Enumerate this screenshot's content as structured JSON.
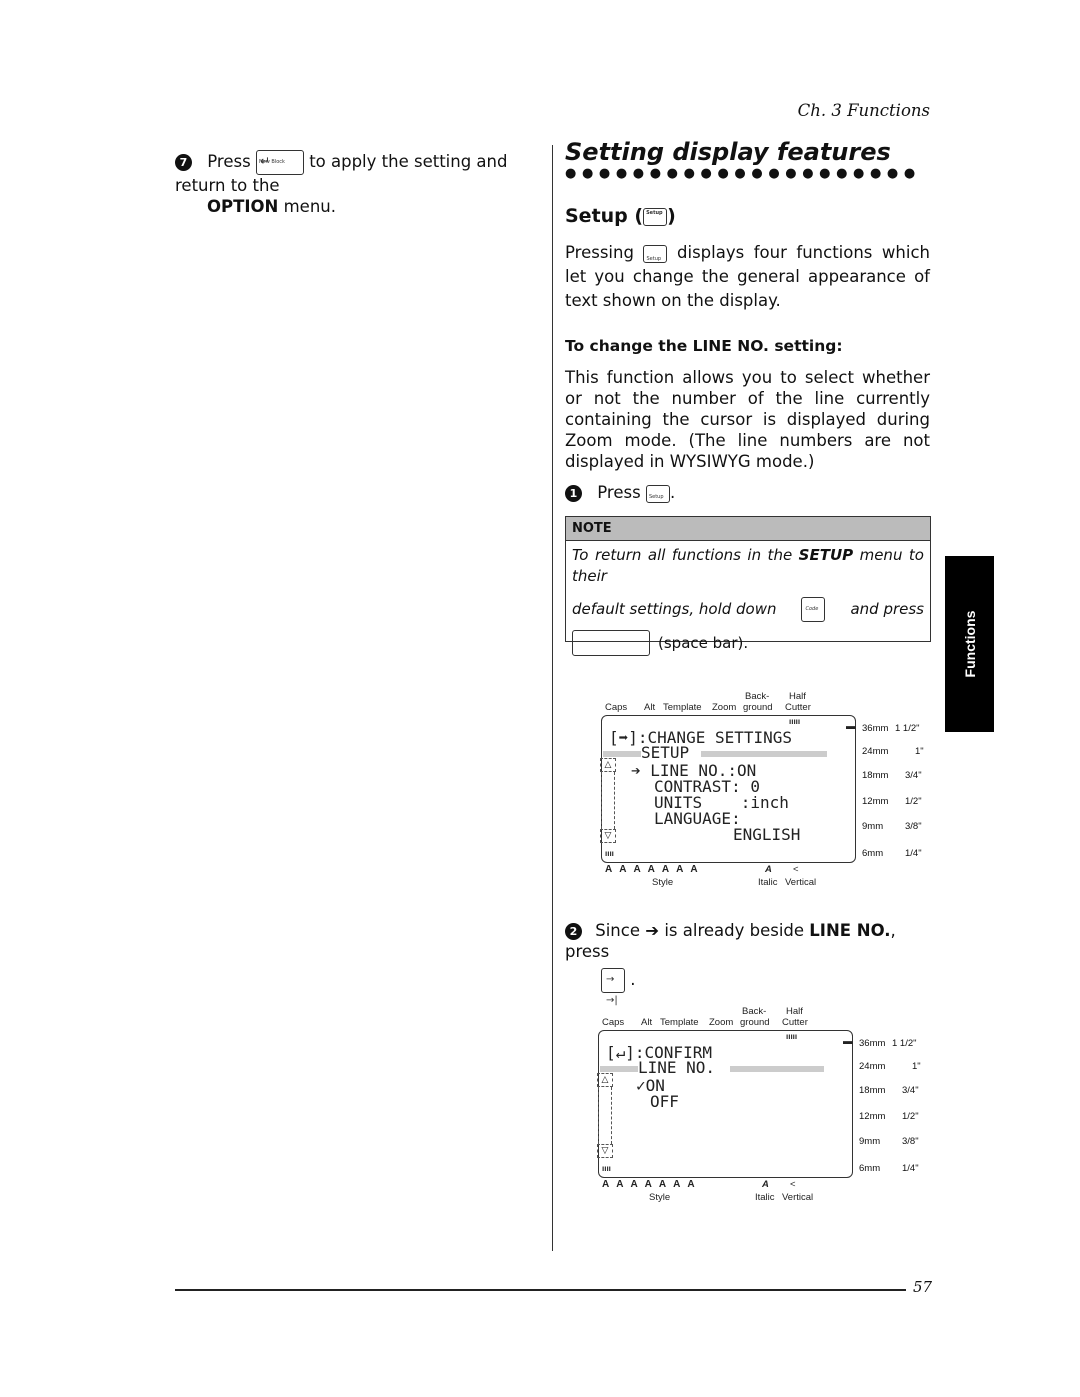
{
  "header": {
    "chapter": "Ch. 3 Functions"
  },
  "left": {
    "step_num": "7",
    "press": "Press",
    "key_label": "New Block",
    "rest": "to apply the setting and return to the",
    "option": "OPTION",
    "menu": "menu."
  },
  "right": {
    "title": "Setting display features",
    "setup_heading": "Setup (",
    "setup_heading_end": ")",
    "setup_key": "Setup",
    "intro_a": "Pressing",
    "intro_b": "displays four functions which let you change the general appearance of text shown on the display.",
    "subheading": "To change the LINE NO. setting:",
    "body": "This function allows you to select whether or not the number of the line currently containing the cursor is displayed during Zoom mode. (The line numbers are not displayed in WYSIWYG mode.)",
    "step1_num": "1",
    "step1_text": "Press",
    "note": {
      "title": "NOTE",
      "line1a": "To return all functions in the",
      "setup": "SETUP",
      "line1b": "menu to their",
      "line2a": "default settings, hold down",
      "code_key": "Code",
      "line2b": "and press",
      "line3": "(space bar)."
    },
    "step2_num": "2",
    "step2_a": "Since",
    "step2_b": "is already beside",
    "lineno": "LINE NO.",
    "step2_c": ", press"
  },
  "lcd_labels": {
    "caps": "Caps",
    "alt": "Alt",
    "template": "Template",
    "zoom": "Zoom",
    "back": "Back-",
    "ground": "ground",
    "half": "Half",
    "cutter": "Cutter",
    "style": "Style",
    "italic": "Italic",
    "vertical": "Vertical"
  },
  "sizes": [
    {
      "mm": "36mm",
      "in": "1 1/2\""
    },
    {
      "mm": "24mm",
      "in": "1\""
    },
    {
      "mm": "18mm",
      "in": "3/4\""
    },
    {
      "mm": "12mm",
      "in": "1/2\""
    },
    {
      "mm": "9mm",
      "in": "3/8\""
    },
    {
      "mm": "6mm",
      "in": "1/4\""
    }
  ],
  "lcd1": {
    "l1": "[➡]:CHANGE SETTINGS",
    "l2": "SETUP",
    "l3": "➔ LINE NO.:ON",
    "l4": "CONTRAST: 0",
    "l5": "UNITS    :inch",
    "l6": "LANGUAGE:",
    "l7": "ENGLISH"
  },
  "lcd2": {
    "l1": "[↵]:CONFIRM",
    "l2": "LINE NO.",
    "l3": "✓ON",
    "l4": "OFF"
  },
  "side_tab": "Functions",
  "page_number": "57"
}
